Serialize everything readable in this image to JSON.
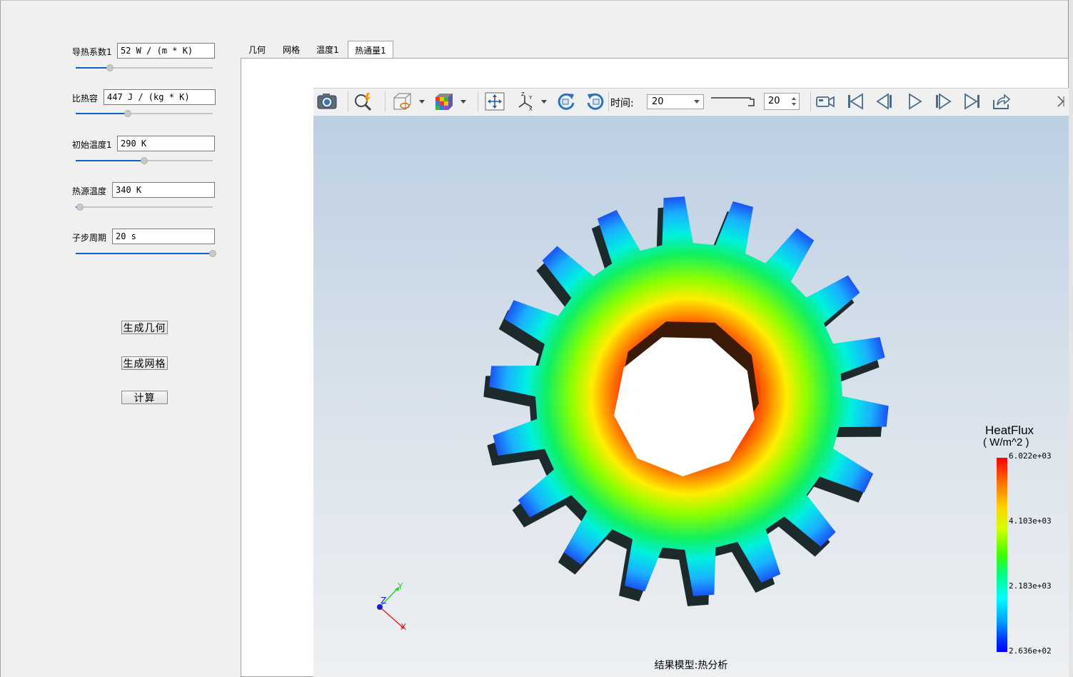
{
  "params": [
    {
      "label": "导热系数1",
      "value": "52 W / (m * K)",
      "slider": 0.25
    },
    {
      "label": "比热容",
      "value": "447 J / (kg * K)",
      "slider": 0.38
    },
    {
      "label": "初始温度1",
      "value": "290 K",
      "slider": 0.5
    },
    {
      "label": "热源温度",
      "value": "340 K",
      "slider": 0.03
    },
    {
      "label": "子步周期",
      "value": "20 s",
      "slider": 1.0
    }
  ],
  "buttons": {
    "gen_geometry": "生成几何",
    "gen_mesh": "生成网格",
    "compute": "计算"
  },
  "tabs": [
    {
      "label": "几何",
      "active": false
    },
    {
      "label": "网格",
      "active": false
    },
    {
      "label": "温度1",
      "active": false
    },
    {
      "label": "热通量1",
      "active": true
    }
  ],
  "toolbar": {
    "time_label": "时间:",
    "time_value": "20",
    "spin_value": "20",
    "icons": [
      "camera-icon",
      "zoom-icon",
      "box-view-icon",
      "cube-color-icon",
      "fit-view-icon",
      "axes-icon",
      "rotate-cw-icon",
      "rotate-ccw-icon",
      "video-icon",
      "first-frame-icon",
      "prev-frame-icon",
      "play-icon",
      "next-frame-icon",
      "last-frame-icon",
      "export-icon"
    ]
  },
  "viewport": {
    "caption": "结果模型:热分析",
    "triad": {
      "x": "X",
      "y": "Y",
      "z": "Z"
    }
  },
  "legend": {
    "title": "HeatFlux",
    "unit": "( W/m^2 )",
    "ticks": [
      "6.022e+03",
      "4.103e+03",
      "2.183e+03",
      "2.636e+02"
    ],
    "colors": {
      "max": "#ff0000",
      "mid": "#40ff00",
      "low": "#00ffff",
      "min": "#0000ff"
    }
  }
}
